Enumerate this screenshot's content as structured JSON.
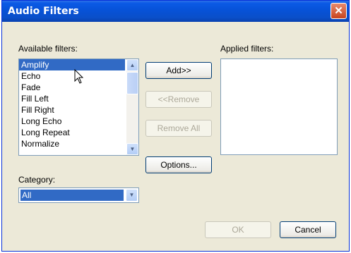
{
  "window": {
    "title": "Audio Filters",
    "close_glyph": "✕"
  },
  "available": {
    "label": "Available filters:",
    "items": [
      "Amplify",
      "Echo",
      "Fade",
      "Fill Left",
      "Fill Right",
      "Long Echo",
      "Long Repeat",
      "Normalize"
    ],
    "selected": "Amplify"
  },
  "applied": {
    "label": "Applied filters:",
    "items": []
  },
  "buttons": {
    "add": "Add>>",
    "remove": "<<Remove",
    "remove_all": "Remove All",
    "options": "Options...",
    "ok": "OK",
    "cancel": "Cancel"
  },
  "category": {
    "label": "Category:",
    "value": "All"
  },
  "icons": {
    "scroll_up": "chevron-up-icon",
    "scroll_down": "chevron-down-icon",
    "cursor": "mouse-pointer-icon"
  },
  "colors": {
    "titlebar": "#0752d8",
    "selection": "#316ac5",
    "dialog_bg": "#ece9d8",
    "close": "#c9441e"
  }
}
